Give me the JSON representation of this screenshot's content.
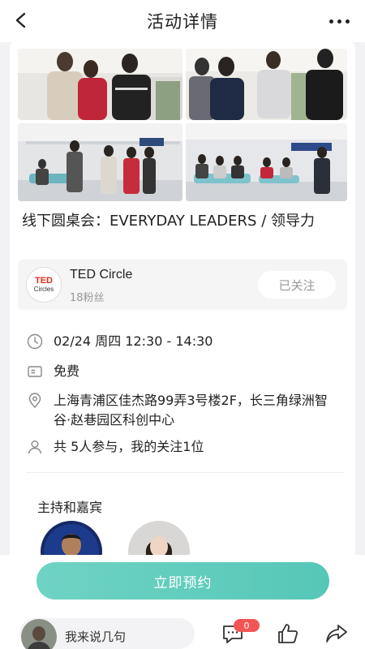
{
  "header": {
    "title": "活动详情"
  },
  "event": {
    "title": "线下圆桌会：EVERYDAY LEADERS / 领导力"
  },
  "organizer": {
    "logo_line1": "TED",
    "logo_line2": "Circles",
    "name": "TED Circle",
    "fans": "18粉丝",
    "follow_label": "已关注"
  },
  "details": {
    "time": "02/24 周四 12:30 - 14:30",
    "fee": "免费",
    "address": "上海青浦区佳杰路99弄3号楼2F，长三角绿洲智谷·赵巷园区科创中心",
    "participants": "共 5人参与，我的关注1位"
  },
  "hosts": {
    "section_title": "主持和嘉宾"
  },
  "actions": {
    "reserve_label": "立即预约"
  },
  "bottom_bar": {
    "comment_placeholder": "我来说几句",
    "comment_count": "0"
  },
  "icons": [
    "back-icon",
    "more-icon",
    "clock-icon",
    "ticket-icon",
    "location-icon",
    "person-icon",
    "comment-icon",
    "like-icon",
    "share-icon"
  ],
  "colors": {
    "accent": "#5ecbbb",
    "badge": "#f25555",
    "ted_red": "#e62b1e"
  }
}
